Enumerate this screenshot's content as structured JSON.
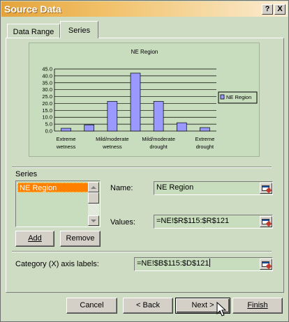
{
  "window": {
    "title": "Source Data"
  },
  "titlebar": {
    "help_label": "?",
    "close_label": "X"
  },
  "tabs": [
    {
      "label": "Data Range"
    },
    {
      "label": "Series"
    }
  ],
  "chart_data": {
    "type": "bar",
    "title": "NE Region",
    "categories": [
      "Extreme wetness",
      "",
      "Mild/moderate wetness",
      "",
      "Mild/moderate drought",
      "",
      "Extreme drought"
    ],
    "category_tick_labels": [
      {
        "line1": "Extreme",
        "line2": "wetness"
      },
      {
        "line1": "Mild/moderate",
        "line2": "wetness"
      },
      {
        "line1": "Mild/moderate",
        "line2": "drought"
      },
      {
        "line1": "Extreme",
        "line2": "drought"
      }
    ],
    "series": [
      {
        "name": "NE Region",
        "values": [
          2,
          4.5,
          21.5,
          42,
          21.5,
          6,
          2.5
        ]
      }
    ],
    "ylim": [
      0,
      45
    ],
    "yticks": [
      "0.0",
      "5.0",
      "10.0",
      "15.0",
      "20.0",
      "25.0",
      "30.0",
      "35.0",
      "40.0",
      "45.0"
    ],
    "grid": true,
    "legend": "right",
    "bar_color": "#9999ff"
  },
  "series_section": {
    "label": "Series",
    "items": [
      {
        "label": "NE Region",
        "selected": true
      }
    ],
    "add_label": "Add",
    "remove_label": "Remove"
  },
  "fields": {
    "name_label": "Name:",
    "name_value": "NE Region",
    "values_label": "Values:",
    "values_value": "=NE!$R$115:$R$121",
    "category_label": "Category (X) axis labels:",
    "category_value": "=NE!$B$115:$D$121"
  },
  "footer": {
    "cancel": "Cancel",
    "back": "< Back",
    "next": "Next >",
    "finish": "Finish"
  }
}
